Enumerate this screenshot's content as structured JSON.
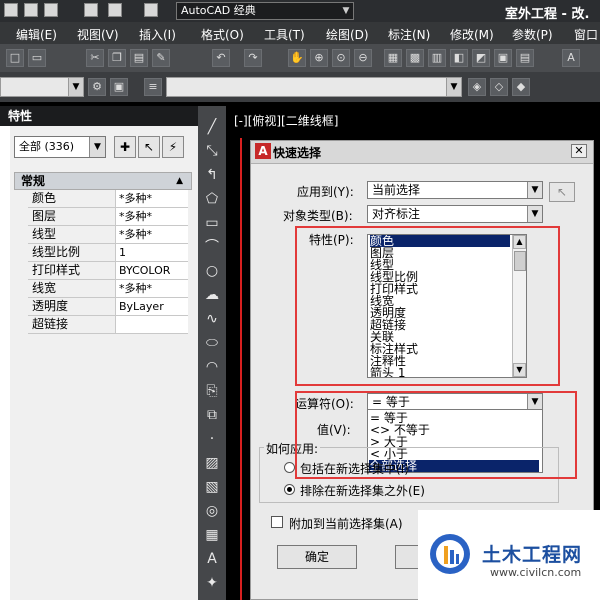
{
  "titlebar": {
    "workspace": "AutoCAD 经典",
    "app_title": "室外工程 - 改."
  },
  "menu": {
    "items": [
      "编辑(E)",
      "视图(V)",
      "插入(I)",
      "格式(O)",
      "工具(T)",
      "绘图(D)",
      "标注(N)",
      "修改(M)",
      "参数(P)",
      "窗口"
    ]
  },
  "palette": {
    "title": "特性",
    "selection": "全部 (336)",
    "category": "常规",
    "rows": [
      {
        "name": "颜色",
        "value": "*多种*"
      },
      {
        "name": "图层",
        "value": "*多种*"
      },
      {
        "name": "线型",
        "value": "*多种*"
      },
      {
        "name": "线型比例",
        "value": "1"
      },
      {
        "name": "打印样式",
        "value": "BYCOLOR"
      },
      {
        "name": "线宽",
        "value": "*多种*"
      },
      {
        "name": "透明度",
        "value": "ByLayer"
      },
      {
        "name": "超链接",
        "value": ""
      }
    ]
  },
  "viewport": {
    "label": "[-][俯视][二维线框]"
  },
  "dialog": {
    "title": "快速选择",
    "apply_to_label": "应用到(Y):",
    "apply_to_value": "当前选择",
    "object_type_label": "对象类型(B):",
    "object_type_value": "对齐标注",
    "properties_label": "特性(P):",
    "properties": [
      "颜色",
      "图层",
      "线型",
      "线型比例",
      "打印样式",
      "线宽",
      "透明度",
      "超链接",
      "关联",
      "标注样式",
      "注释性",
      "箭头 1"
    ],
    "operator_label": "运算符(O):",
    "operator_value": "= 等于",
    "operator_options": [
      "= 等于",
      "<> 不等于",
      "> 大于",
      "< 小于",
      "全部选择"
    ],
    "value_label": "值(V):",
    "how_to_apply_label": "如何应用:",
    "radio_include": "包括在新选择集中(I)",
    "radio_exclude": "排除在新选择集之外(E)",
    "append_label": "附加到当前选择集(A)",
    "ok_label": "确定",
    "cancel_label": "取"
  },
  "watermark": {
    "title": "土木工程网",
    "url": "www.civilcn.com"
  }
}
